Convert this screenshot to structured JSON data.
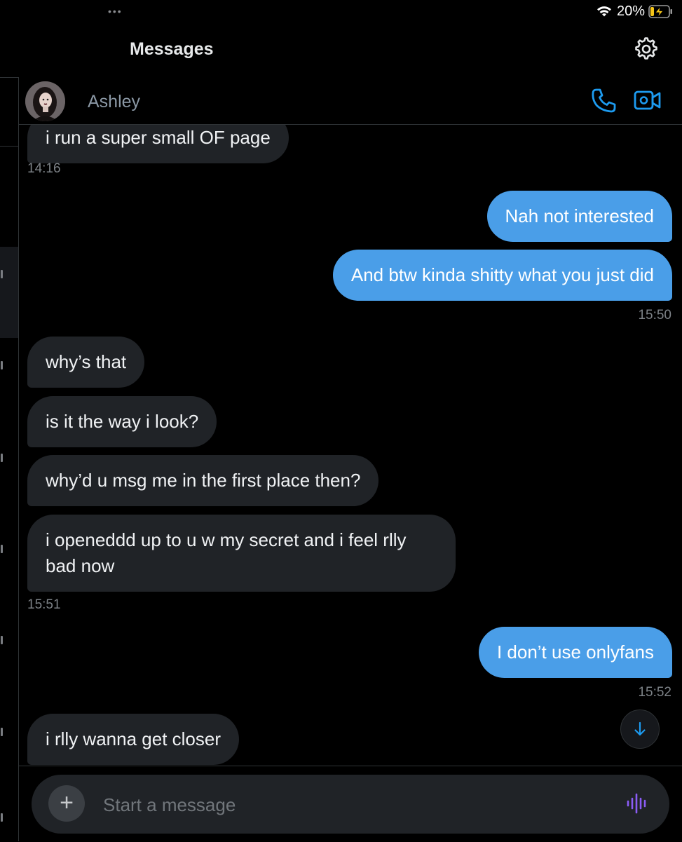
{
  "status_bar": {
    "dots": "•••",
    "battery_percent": "20%",
    "battery_level": 0.2,
    "charging": true
  },
  "header": {
    "title": "Messages",
    "settings_icon": "gear-icon"
  },
  "conversation": {
    "name": "Ashley",
    "call_icon": "phone-icon",
    "video_icon": "video-call-icon"
  },
  "messages": [
    {
      "direction": "incoming",
      "text": "i run a super small OF page"
    },
    {
      "direction": "outgoing",
      "text": "Nah not interested"
    },
    {
      "direction": "outgoing",
      "text": "And btw kinda shitty what you just did"
    },
    {
      "direction": "incoming",
      "text": "why’s that"
    },
    {
      "direction": "incoming",
      "text": "is it the way i look?"
    },
    {
      "direction": "incoming",
      "text": "why’d u msg me in the first place then?"
    },
    {
      "direction": "incoming",
      "text": "i openeddd up to u w my secret and i feel rlly bad now"
    },
    {
      "direction": "outgoing",
      "text": "I don’t use onlyfans"
    },
    {
      "direction": "incoming",
      "text": "i rlly wanna get closer"
    }
  ],
  "timestamps": [
    "14:16",
    "15:50",
    "15:51",
    "15:52"
  ],
  "scroll_down_icon": "arrow-down-icon",
  "composer": {
    "placeholder": "Start a message",
    "add_label": "+",
    "voice_icon": "voice-waveform-icon"
  },
  "colors": {
    "outgoing_bubble": "#4a9ee8",
    "incoming_bubble": "#202327",
    "accent": "#1d9bf0",
    "voice_accent": "#8b5cf6"
  }
}
